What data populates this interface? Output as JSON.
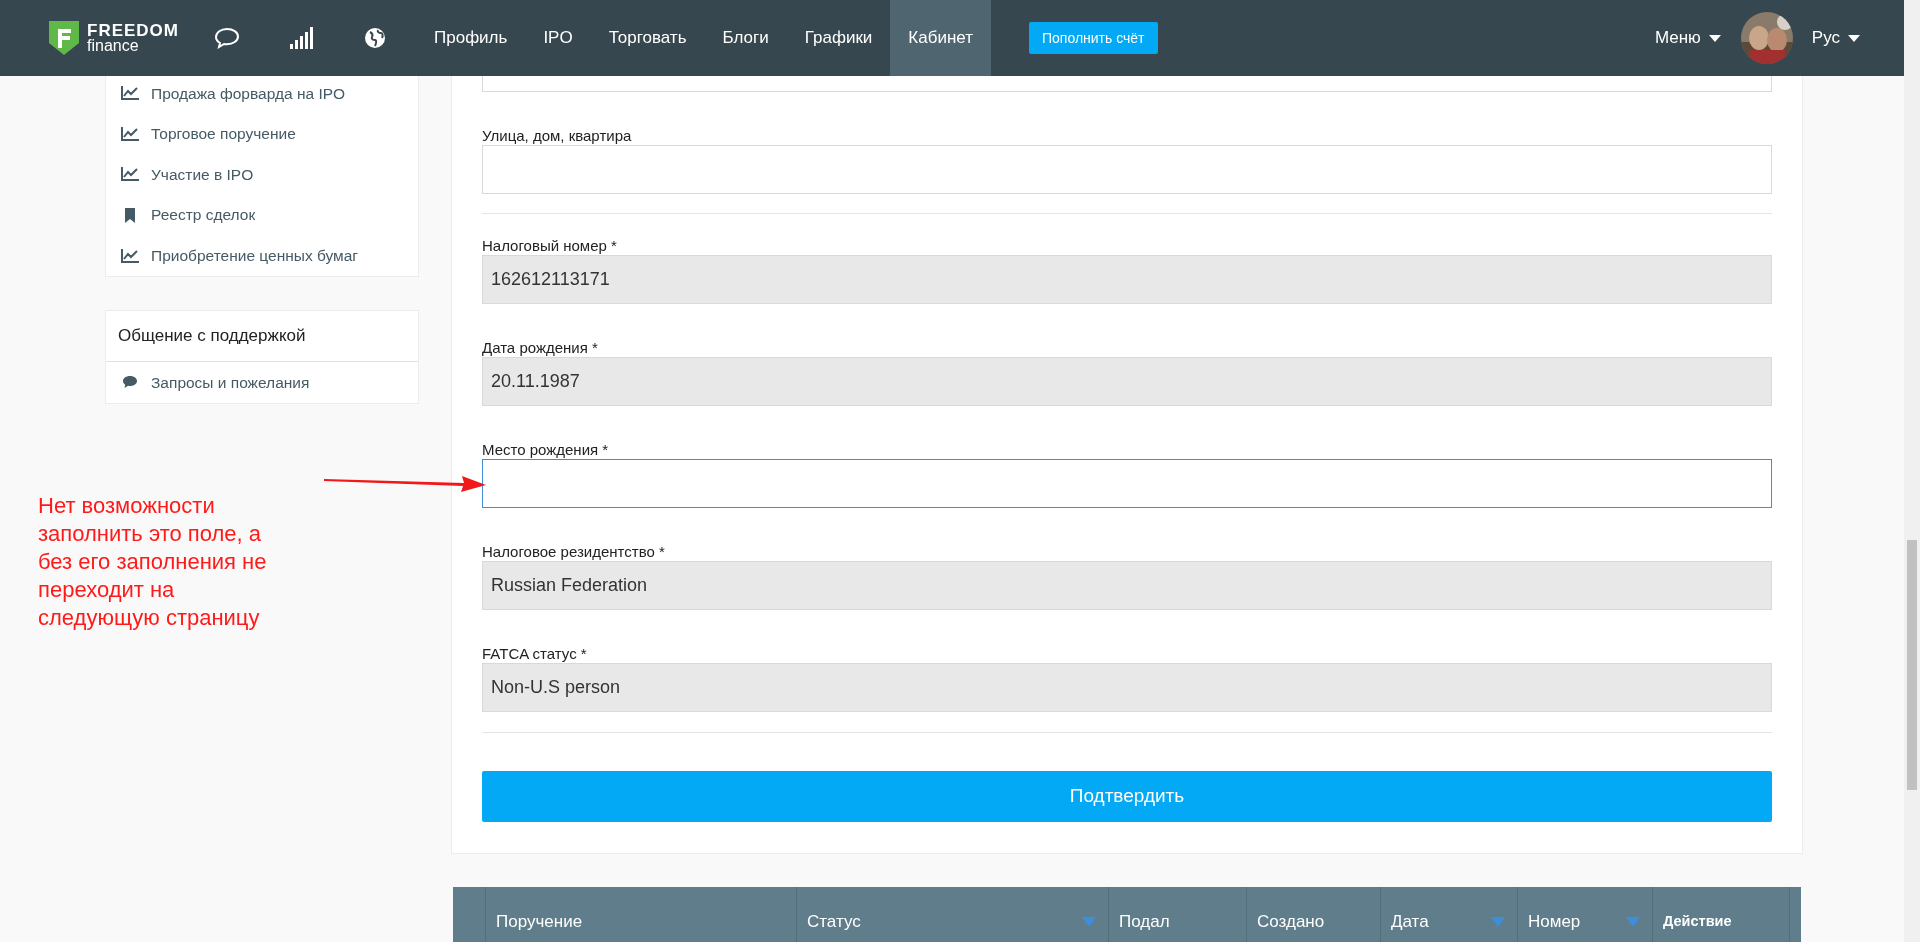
{
  "logo": {
    "title": "FREEDOM",
    "subtitle": "finance"
  },
  "nav": {
    "items": [
      {
        "label": "Профиль",
        "selected": false
      },
      {
        "label": "IPO",
        "selected": false
      },
      {
        "label": "Торговать",
        "selected": false
      },
      {
        "label": "Блоги",
        "selected": false
      },
      {
        "label": "Графики",
        "selected": false
      },
      {
        "label": "Кабинет",
        "selected": true
      }
    ],
    "deposit_button": "Пополнить счёт",
    "menu": "Меню",
    "language": "Рус"
  },
  "sidebar": {
    "items": [
      {
        "label": "Продажа форварда на IPO",
        "kind": "chart"
      },
      {
        "label": "Торговое поручение",
        "kind": "chart"
      },
      {
        "label": "Участие в IPO",
        "kind": "chart"
      },
      {
        "label": "Реестр сделок",
        "kind": "bookmark"
      },
      {
        "label": "Приобретение ценных бумаг",
        "kind": "chart"
      }
    ],
    "support": {
      "title": "Общение с поддержкой",
      "items": [
        {
          "label": "Запросы и пожелания",
          "kind": "chat"
        }
      ]
    }
  },
  "form": {
    "sections": [
      {
        "fields": [
          {
            "disabled": false,
            "focused": false
          },
          {
            "label": "Улица, дом, квартира",
            "disabled": false,
            "focused": false
          }
        ]
      },
      {
        "fields": [
          {
            "label": "Налоговый номер *",
            "value": "162612113171",
            "disabled": true,
            "focused": false
          },
          {
            "label": "Дата рождения *",
            "value": "20.11.1987",
            "disabled": true,
            "focused": false
          },
          {
            "label": "Место рождения *",
            "disabled": false,
            "focused": true
          },
          {
            "label": "Налоговое резидентство *",
            "value": "Russian Federation",
            "disabled": true,
            "focused": false
          },
          {
            "label": "FATCA статус *",
            "value": "Non-U.S person",
            "disabled": true,
            "focused": false
          }
        ]
      }
    ],
    "submit": "Подтвердить"
  },
  "table": {
    "columns": [
      {
        "label": "Поручение",
        "sortable": false,
        "kind": "normal"
      },
      {
        "label": "Статус",
        "sortable": true,
        "kind": "normal"
      },
      {
        "label": "Подал",
        "sortable": false,
        "kind": "normal"
      },
      {
        "label": "Создано",
        "sortable": false,
        "kind": "normal"
      },
      {
        "label": "Дата",
        "sortable": true,
        "kind": "normal"
      },
      {
        "label": "Номер",
        "sortable": true,
        "kind": "normal"
      },
      {
        "label": "Действие",
        "sortable": false,
        "kind": "action"
      }
    ]
  },
  "annotation": {
    "text": "Нет возможности заполнить это поле, а без его заполнения не переходит на следующую страницу"
  }
}
